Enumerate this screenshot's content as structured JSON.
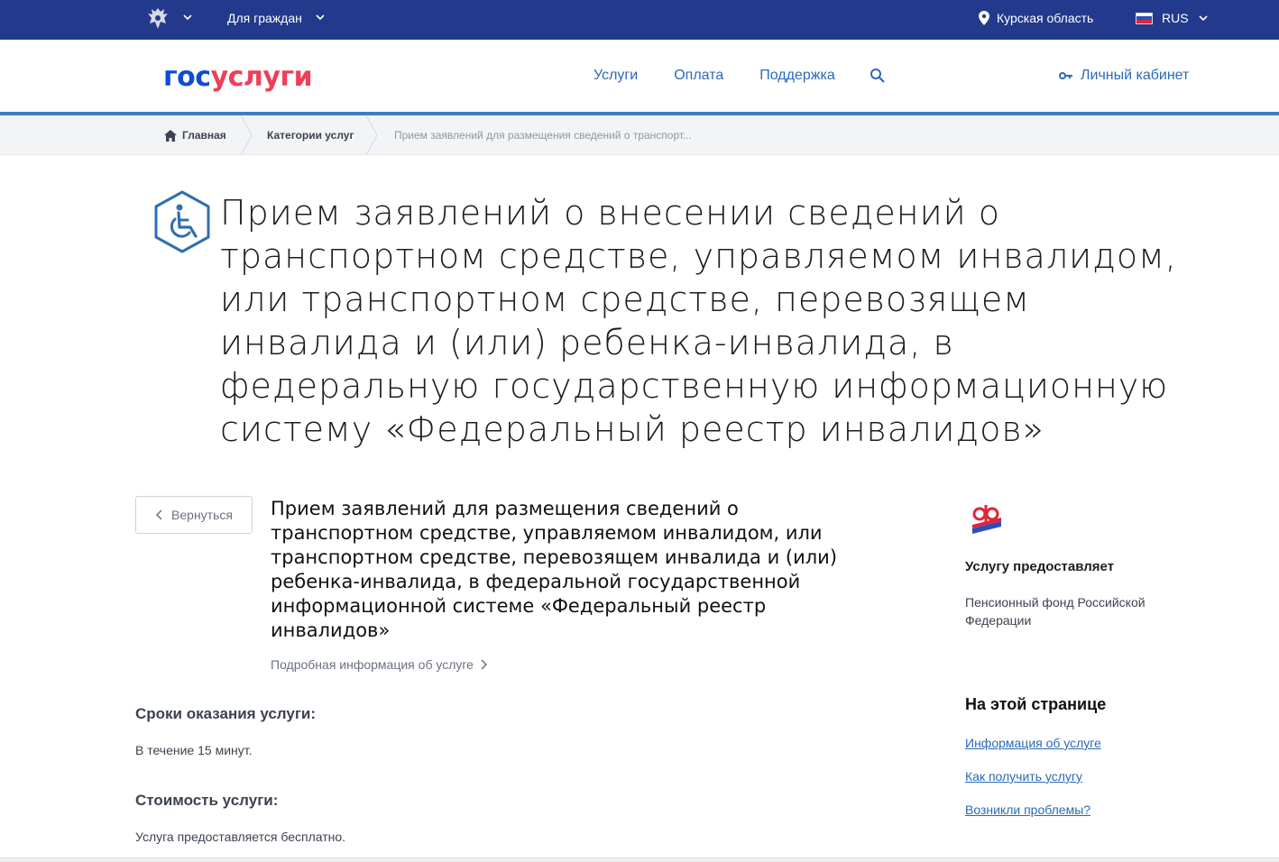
{
  "topbar": {
    "for_citizens": "Для граждан",
    "region": "Курская область",
    "language": "RUS"
  },
  "header": {
    "logo_part1": "гос",
    "logo_part2": "услуги",
    "nav": [
      "Услуги",
      "Оплата",
      "Поддержка"
    ],
    "cabinet": "Личный кабинет"
  },
  "breadcrumb": {
    "home": "Главная",
    "category": "Категории услуг",
    "current": "Прием заявлений для размещения сведений о транспорт..."
  },
  "page": {
    "title": "Прием заявлений о внесении сведений о транспортном средстве, управляемом инвалидом, или транспортном средстве, перевозящем инвалида и (или) ребенка-инвалида, в федеральную государственную информационную систему «Федеральный реестр инвалидов»",
    "back_label": "Вернуться",
    "service_name": "Прием заявлений для размещения сведений о транспортном средстве, управляемом инвалидом, или транспортном средстве, перевозящем инвалида и (или) ребенка-инвалида, в федеральной государственной информационной системе «Федеральный реестр инвалидов»",
    "more_info": "Подробная информация об услуге",
    "terms_heading": "Сроки оказания услуги:",
    "terms_text": "В течение 15 минут.",
    "cost_heading": "Стоимость услуги:",
    "cost_text": "Услуга предоставляется бесплатно."
  },
  "sidebar": {
    "provider_heading": "Услугу предоставляет",
    "provider_name": "Пенсионный фонд Российской Федерации",
    "onpage_heading": "На этой странице",
    "links": [
      "Информация об услуге",
      "Как получить услугу",
      "Возникли проблемы?"
    ]
  },
  "colors": {
    "topbar_bg": "#233a8c",
    "logo_blue": "#0d4cd3",
    "logo_red": "#ee3f58",
    "link": "#2b6ab8",
    "icon_blue": "#2f6fae"
  }
}
